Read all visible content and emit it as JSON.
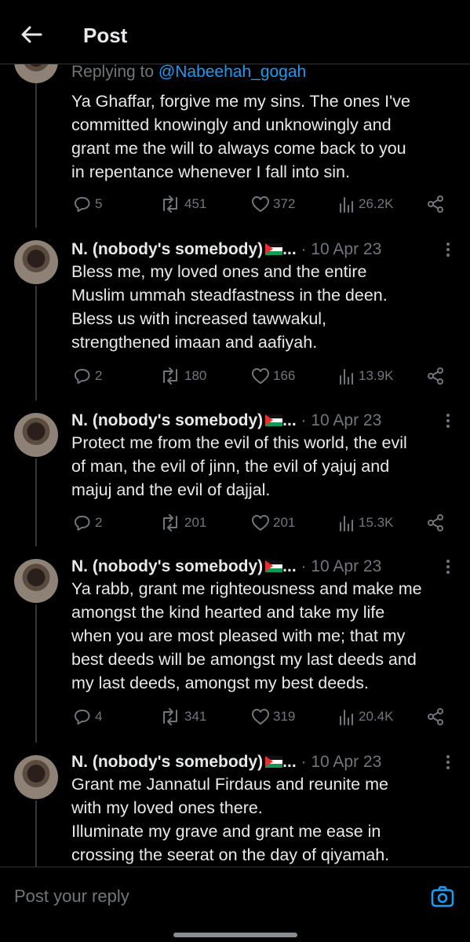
{
  "header": {
    "title": "Post"
  },
  "first_reply": {
    "replying_prefix": "Replying to",
    "replying_handle": "@Nabeehah_gogah",
    "text": [
      "Ya Ghaffar, forgive me my sins. The ones I've",
      "committed knowingly and unknowingly and",
      "grant me the will to always come back to you",
      "in repentance whenever I fall into sin."
    ],
    "stats": {
      "replies": "5",
      "reposts": "451",
      "likes": "372",
      "views": "26.2K"
    }
  },
  "posts": [
    {
      "name": "N. (nobody's somebody)",
      "ellipsis": "...",
      "date": "· 10 Apr 23",
      "text": [
        "Bless me, my loved ones and the entire",
        "Muslim ummah steadfastness in the deen.",
        "Bless us with increased tawwakul,",
        "strengthened imaan and aafiyah."
      ],
      "stats": {
        "replies": "2",
        "reposts": "180",
        "likes": "166",
        "views": "13.9K"
      }
    },
    {
      "name": "N. (nobody's somebody)",
      "ellipsis": "...",
      "date": "· 10 Apr 23",
      "text": [
        "Protect me from the evil of this world, the evil",
        "of man, the evil of jinn, the evil of yajuj and",
        "majuj and the evil of dajjal."
      ],
      "stats": {
        "replies": "2",
        "reposts": "201",
        "likes": "201",
        "views": "15.3K"
      }
    },
    {
      "name": "N. (nobody's somebody)",
      "ellipsis": "...",
      "date": "· 10 Apr 23",
      "text": [
        "Ya rabb, grant me righteousness and make me",
        "amongst the kind hearted and take my life",
        "when you are most pleased with me; that my",
        "best deeds will be amongst my last deeds and",
        "my last deeds, amongst my best deeds."
      ],
      "stats": {
        "replies": "4",
        "reposts": "341",
        "likes": "319",
        "views": "20.4K"
      }
    },
    {
      "name": "N. (nobody's somebody)",
      "ellipsis": "...",
      "date": "· 10 Apr 23",
      "text": [
        "Grant me Jannatul Firdaus and reunite me",
        "with my loved ones there.",
        "Illuminate my grave and grant me ease in",
        "crossing the seerat on the day of qiyamah."
      ]
    }
  ],
  "composer": {
    "placeholder": "Post your reply"
  },
  "icons": {
    "back": "arrow-left-icon",
    "camera": "camera-icon",
    "reply": "speech-bubble-icon",
    "repost": "repost-icon",
    "like": "heart-icon",
    "views": "bar-chart-icon",
    "share": "share-icon",
    "more": "more-vertical-icon"
  },
  "colors": {
    "background": "#000000",
    "text": "#e7e9ea",
    "muted": "#71767b",
    "link": "#1d9bf0"
  }
}
